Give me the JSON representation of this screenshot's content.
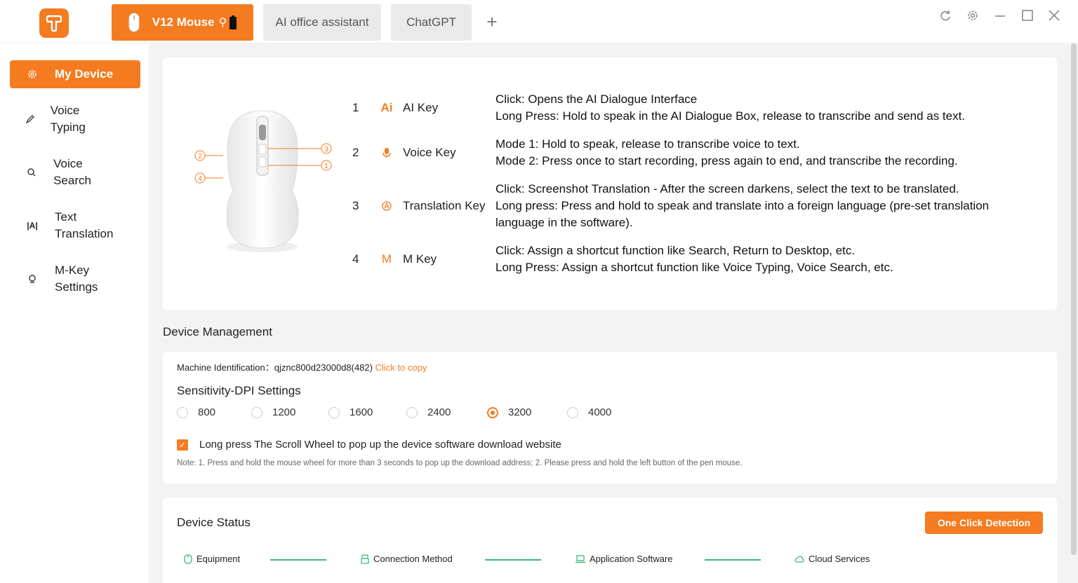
{
  "tabs": [
    {
      "label": "V12 Mouse",
      "active": true
    },
    {
      "label": "AI office assistant",
      "active": false
    },
    {
      "label": "ChatGPT",
      "active": false
    }
  ],
  "tab_add": "+",
  "sidebar": {
    "items": [
      {
        "label": "My Device",
        "icon": "gear-icon",
        "active": true
      },
      {
        "label": "Voice Typing",
        "icon": "pen-icon"
      },
      {
        "label": "Voice Search",
        "icon": "search-icon"
      },
      {
        "label": "Text Translation",
        "icon": "translate-icon"
      },
      {
        "label": "M-Key Settings",
        "icon": "mkey-icon"
      }
    ]
  },
  "mouse_callouts": [
    "1",
    "2",
    "3",
    "4"
  ],
  "keys": [
    {
      "num": "1",
      "icon_text": "Ai",
      "name": "AI Key",
      "lines": [
        "Click: Opens the AI Dialogue Interface",
        "Long Press: Hold to speak in the AI Dialogue Box, release to transcribe and send as text."
      ]
    },
    {
      "num": "2",
      "icon_text": "",
      "name": "Voice Key",
      "lines": [
        "Mode 1: Hold to speak, release to transcribe voice to text.",
        "Mode 2: Press once to start recording, press again to end, and transcribe the recording."
      ]
    },
    {
      "num": "3",
      "icon_text": "",
      "name": "Translation Key",
      "lines": [
        "Click: Screenshot Translation - After the screen darkens, select the text to be translated.",
        "Long press: Press and hold to speak and translate into a foreign language (pre-set translation",
        "language in the software)."
      ]
    },
    {
      "num": "4",
      "icon_text": "M",
      "name": "M Key",
      "lines": [
        "Click: Assign a shortcut function like Search, Return to Desktop, etc.",
        "Long Press: Assign a shortcut function like Voice Typing, Voice Search, etc."
      ]
    }
  ],
  "device_management": {
    "title": "Device Management",
    "machine_label": "Machine Identification：",
    "machine_id": "qjznc800d23000d8(482)",
    "copy_link": "Click to copy",
    "dpi_title": "Sensitivity-DPI Settings",
    "dpi_options": [
      "800",
      "1200",
      "1600",
      "2400",
      "3200",
      "4000"
    ],
    "dpi_selected": "3200",
    "scroll_option": "Long press The Scroll Wheel to pop up the device software download website",
    "scroll_checked": true,
    "note": "Note: 1. Press and hold the mouse wheel for more than 3 seconds to pop up the download address; 2. Please press and hold the left button of the pen mouse."
  },
  "device_status": {
    "title": "Device Status",
    "button": "One Click Detection",
    "items": [
      "Equipment",
      "Connection Method",
      "Application Software",
      "Cloud Services"
    ]
  },
  "colors": {
    "accent": "#f47b20",
    "ok_green": "#3ab77a"
  }
}
